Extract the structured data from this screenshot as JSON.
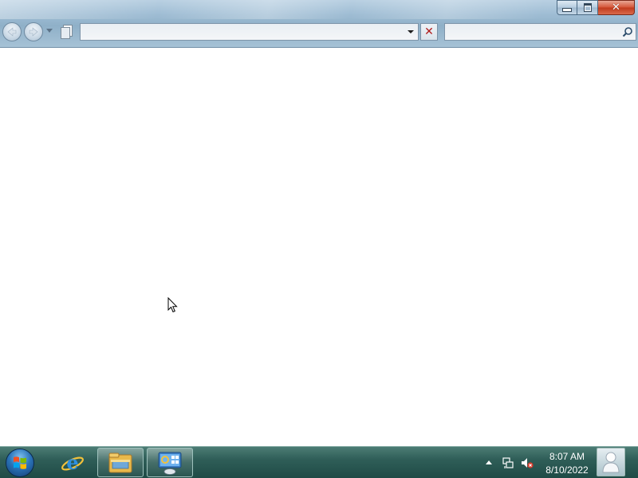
{
  "window": {
    "address_value": "",
    "search_value": "",
    "buttons": {
      "minimize": "minimize",
      "maximize": "maximize",
      "close": "✕",
      "stop": "✕"
    }
  },
  "taskbar": {
    "pinned": [
      {
        "name": "start-button",
        "icon": "windows-orb-icon"
      },
      {
        "name": "internet-explorer",
        "icon": "internet-explorer-icon"
      },
      {
        "name": "windows-explorer",
        "icon": "folder-icon"
      },
      {
        "name": "control-panel",
        "icon": "control-panel-icon",
        "active": true
      }
    ],
    "tray": {
      "icons": [
        "show-hidden-icons-arrow",
        "network-icon",
        "volume-muted-icon"
      ]
    },
    "clock": {
      "time": "8:07 AM",
      "date": "8/10/2022"
    }
  },
  "colors": {
    "taskbar": "#2f5e58",
    "titlebar": "#9fbdd4",
    "close_button": "#c03a1c"
  }
}
